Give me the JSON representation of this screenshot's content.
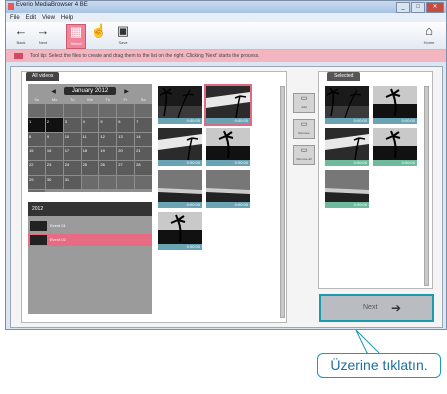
{
  "window": {
    "title": "Everio MediaBrowser 4 BE"
  },
  "menu": [
    "File",
    "Edit",
    "View",
    "Help"
  ],
  "toolbar": {
    "items": [
      {
        "label": "Back",
        "icon": "back-arrow-icon"
      },
      {
        "label": "Next",
        "icon": "forward-arrow-icon"
      },
      {
        "label": "Select",
        "icon": "select-icon"
      },
      {
        "label": "",
        "icon": "hand-icon"
      },
      {
        "label": "Save",
        "icon": "save-icon"
      }
    ],
    "home_label": "Home"
  },
  "banner": {
    "text": "Tool tip: Select the files to create and drag them to the list on the right. Clicking 'Next' starts the process."
  },
  "left_panel": {
    "tab": "All videos"
  },
  "calendar": {
    "month": "January 2012",
    "days": [
      "Su",
      "Mo",
      "Tu",
      "We",
      "Th",
      "Fr",
      "Sa"
    ],
    "cells": [
      "",
      "",
      "",
      "",
      "",
      "",
      "",
      "1",
      "2",
      "3",
      "4",
      "5",
      "6",
      "7",
      "8",
      "9",
      "10",
      "11",
      "12",
      "13",
      "14",
      "15",
      "16",
      "17",
      "18",
      "19",
      "20",
      "21",
      "22",
      "23",
      "24",
      "25",
      "26",
      "27",
      "28",
      "29",
      "30",
      "31",
      "",
      "",
      "",
      "",
      ""
    ]
  },
  "events": {
    "year": "2012",
    "items": [
      {
        "label": "Event 01",
        "selected": false
      },
      {
        "label": "Event 02",
        "selected": true
      }
    ]
  },
  "thumbnails": [
    {
      "time": "0:00:00",
      "selected": false
    },
    {
      "time": "0:00:00",
      "selected": true
    },
    {
      "time": "0:00:00",
      "selected": false
    },
    {
      "time": "0:00:00",
      "selected": false
    },
    {
      "time": "0:00:00",
      "selected": false
    },
    {
      "time": "0:00:00",
      "selected": false
    },
    {
      "time": "0:00:00",
      "selected": false
    }
  ],
  "middle_buttons": [
    {
      "label": "Add",
      "icon": "add-icon"
    },
    {
      "label": "Remove",
      "icon": "remove-icon"
    },
    {
      "label": "Remove all",
      "icon": "remove-all-icon"
    }
  ],
  "right_panel": {
    "tab": "Selected",
    "thumbnails": [
      {
        "time": "0:00:00",
        "kind": "video"
      },
      {
        "time": "0:00:00",
        "kind": "video"
      },
      {
        "time": "0:00:00",
        "kind": "photo"
      },
      {
        "time": "0:00:00",
        "kind": "photo"
      },
      {
        "time": "0:00:00",
        "kind": "photo"
      }
    ]
  },
  "next_button": {
    "label": "Next"
  },
  "callout": {
    "text": "Üzerine tıklatın."
  },
  "colors": {
    "accent": "#e06a82",
    "callout": "#1a9bb0",
    "banner": "#f3b5c0"
  }
}
